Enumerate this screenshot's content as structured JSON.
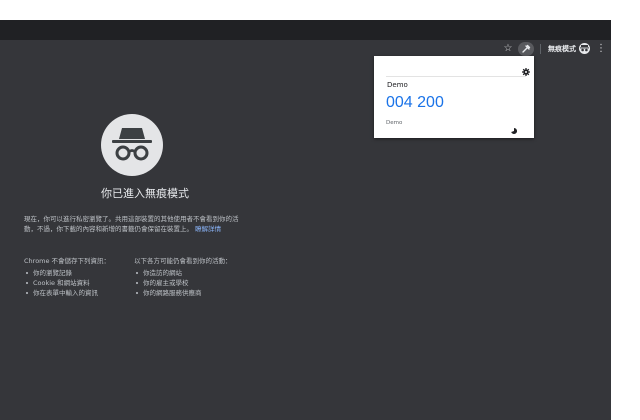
{
  "toolbar": {
    "star_icon": "☆",
    "incognito_label": "無痕模式",
    "menu_icon": "⋮"
  },
  "ntp": {
    "headline": "你已進入無痕模式",
    "intro": "現在，你可以進行私密瀏覽了。共用這部裝置的其他使用者不會看到你的活動，不過，你下載的內容和新增的書籤仍會保留在裝置上。",
    "learn_more": "瞭解詳情",
    "not_saved_heading": "Chrome 不會儲存下列資訊：",
    "not_saved_items": [
      "你的瀏覽記錄",
      "Cookie 和網站資料",
      "你在表單中輸入的資訊"
    ],
    "visible_heading": "以下各方可能仍會看到你的活動：",
    "visible_items": [
      "你造訪的網站",
      "你的雇主或學校",
      "你的網路服務供應商"
    ]
  },
  "popup": {
    "account_name": "Demo",
    "code": "004 200",
    "account_sub": "Demo"
  },
  "colors": {
    "window_bg": "#35363a",
    "titlebar_bg": "#202124",
    "code_blue": "#1a73e8"
  }
}
